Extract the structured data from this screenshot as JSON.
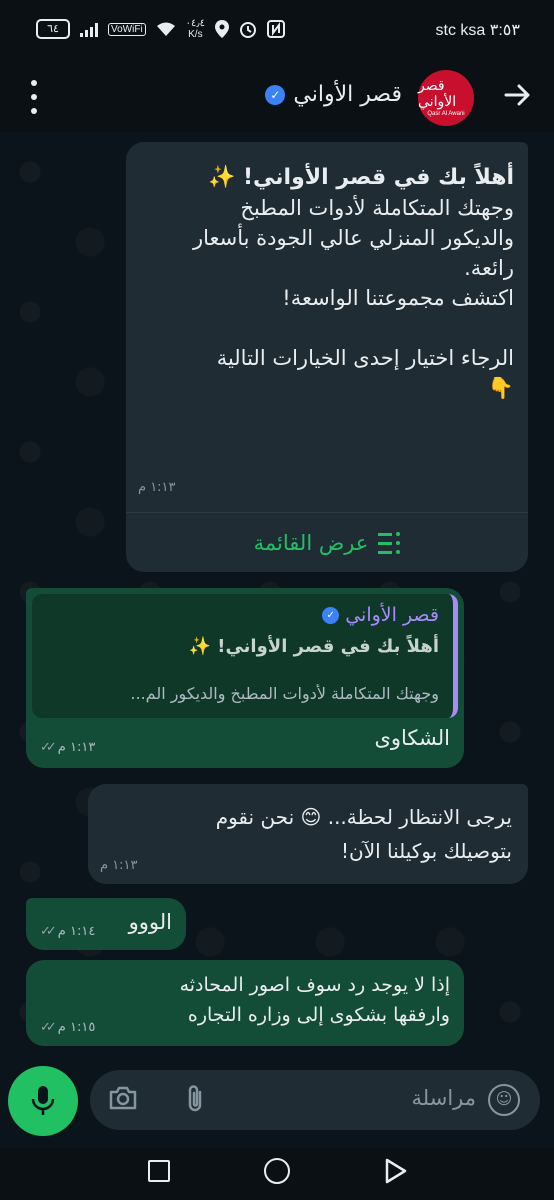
{
  "statusbar": {
    "carrier": "٣:٥٣ stc ksa",
    "battery": "٦٤",
    "vowifi": "VoWiFi",
    "speed_value": "٠٤٫٤",
    "speed_unit": "K/s"
  },
  "header": {
    "contact_name": "قصر الأواني",
    "logo_arabic": "قصر الأواني",
    "logo_latin": "Qasr Al Awani"
  },
  "messages": [
    {
      "direction": "in",
      "title": "أهلاً بك في قصر الأواني! ✨",
      "body": "وجهتك المتكاملة لأدوات المطبخ\nوالديكور المنزلي عالي الجودة بأسعار\nرائعة.\nاكتشف مجموعتنا الواسعة!\n\nالرجاء اختيار إحدى الخيارات التالية\n👇",
      "time": "١:١٣ م",
      "list_button": "عرض القائمة"
    },
    {
      "direction": "out",
      "quote_name": "قصر الأواني",
      "quote_title": "أهلاً بك في قصر الأواني! ✨",
      "quote_body": "وجهتك المتكاملة لأدوات المطبخ والديكور الم...",
      "text": "الشكاوى",
      "time": "١:١٣ م"
    },
    {
      "direction": "in",
      "text": "يرجى الانتظار لحظة... 😊 نحن نقوم\nبتوصيلك بوكيلنا الآن!",
      "time": "١:١٣ م"
    },
    {
      "direction": "out",
      "text": "الووو",
      "time": "١:١٤ م"
    },
    {
      "direction": "out",
      "text": "إذا لا يوجد رد سوف اصور المحادثه\nوارفقها بشكوى إلى وزاره التجاره",
      "time": "١:١٥ م"
    }
  ],
  "input": {
    "placeholder": "مراسلة"
  },
  "colors": {
    "accent": "#21c063",
    "outgoing_bubble": "#144d37",
    "incoming_bubble": "#1f2c33",
    "verified": "#3b82f6",
    "quote_accent": "#a78bfa"
  },
  "icons": [
    "back-arrow-icon",
    "verified-icon",
    "more-vert-icon",
    "list-icon",
    "double-check-icon",
    "emoji-icon",
    "attach-icon",
    "camera-icon",
    "mic-icon"
  ]
}
